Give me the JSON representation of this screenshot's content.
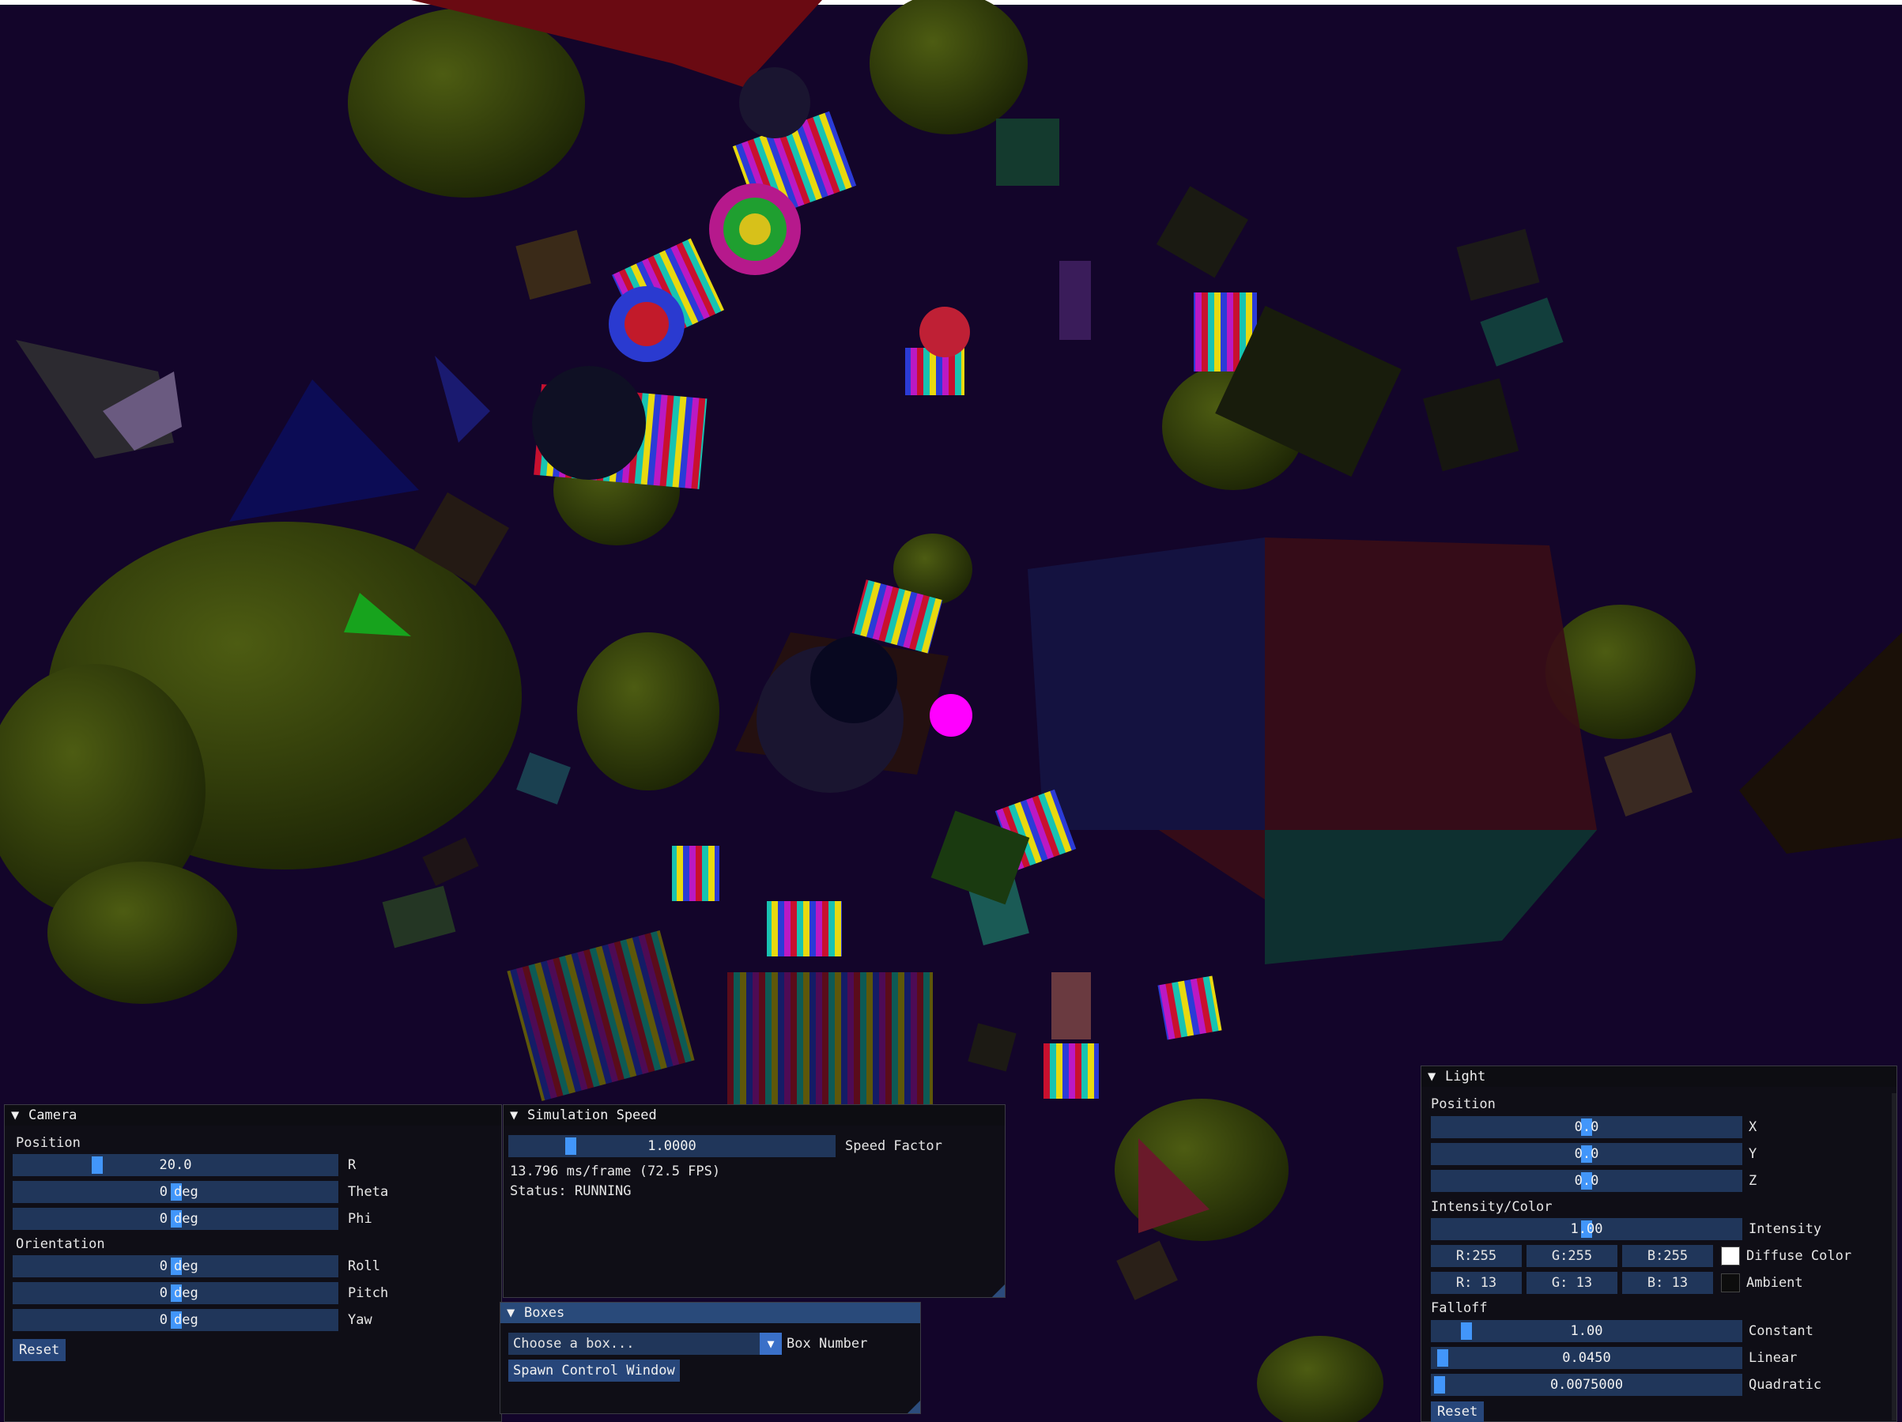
{
  "colors": {
    "background": "#13052a",
    "slider_bg": "#20365a",
    "grab": "#4296fa",
    "title_active": "#294a7a",
    "button": "#27467a"
  },
  "camera": {
    "title": "Camera",
    "position_section": "Position",
    "r": {
      "value": "20.0",
      "label": "R",
      "fraction": 0.25
    },
    "theta": {
      "value": "0",
      "unit": "deg",
      "label": "Theta"
    },
    "phi": {
      "value": "0",
      "unit": "deg",
      "label": "Phi"
    },
    "orientation_section": "Orientation",
    "roll": {
      "value": "0",
      "unit": "deg",
      "label": "Roll"
    },
    "pitch": {
      "value": "0",
      "unit": "deg",
      "label": "Pitch"
    },
    "yaw": {
      "value": "0",
      "unit": "deg",
      "label": "Yaw"
    },
    "reset_label": "Reset"
  },
  "simulation": {
    "title": "Simulation Speed",
    "speed_value": "1.0000",
    "speed_label": "Speed Factor",
    "speed_fraction": 0.18,
    "frame_text": "13.796 ms/frame (72.5 FPS)",
    "status_text": "Status: RUNNING"
  },
  "boxes": {
    "title": "Boxes",
    "combo_value": "Choose a box...",
    "combo_label": "Box Number",
    "spawn_label": "Spawn Control Window"
  },
  "light": {
    "title": "Light",
    "position_section": "Position",
    "x": {
      "value": "0.0",
      "label": "X",
      "fraction": 0.5
    },
    "y": {
      "value": "0.0",
      "label": "Y",
      "fraction": 0.5
    },
    "z": {
      "value": "0.0",
      "label": "Z",
      "fraction": 0.5
    },
    "intensity_section": "Intensity/Color",
    "intensity": {
      "value": "1.00",
      "label": "Intensity",
      "fraction": 0.5
    },
    "diffuse": {
      "r": "R:255",
      "g": "G:255",
      "b": "B:255",
      "label": "Diffuse Color",
      "swatch": "#ffffff"
    },
    "ambient": {
      "r": "R: 13",
      "g": "G: 13",
      "b": "B: 13",
      "label": "Ambient",
      "swatch": "#0d0d0d"
    },
    "falloff_section": "Falloff",
    "constant": {
      "value": "1.00",
      "label": "Constant",
      "fraction": 0.1
    },
    "linear": {
      "value": "0.0450",
      "label": "Linear",
      "fraction": 0.02
    },
    "quadratic": {
      "value": "0.0075000",
      "label": "Quadratic",
      "fraction": 0.01
    },
    "reset_label": "Reset"
  }
}
